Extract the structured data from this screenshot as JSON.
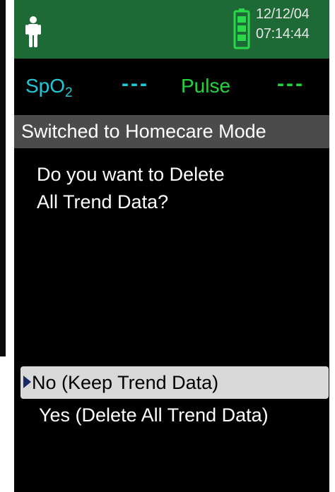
{
  "header": {
    "date": "12/12/04",
    "time": "07:14:44",
    "mode_icon": "person-icon",
    "battery_icon": "battery-icon",
    "bg_color": "#1e6a36"
  },
  "parameters": {
    "spo2": {
      "label_main": "SpO",
      "label_sub": "2",
      "value": "---",
      "color": "#1ec8d6"
    },
    "pulse": {
      "label": "Pulse",
      "value": "---",
      "color": "#22d43a"
    }
  },
  "status": {
    "message": "Switched to Homecare Mode"
  },
  "dialog": {
    "question_line1": "Do you want to Delete",
    "question_line2": "All Trend Data?",
    "options": [
      {
        "label": "No  (Keep Trend Data)",
        "selected": true
      },
      {
        "label": "Yes (Delete All Trend Data)",
        "selected": false
      }
    ],
    "selection_icon": "selection-arrow-icon"
  }
}
